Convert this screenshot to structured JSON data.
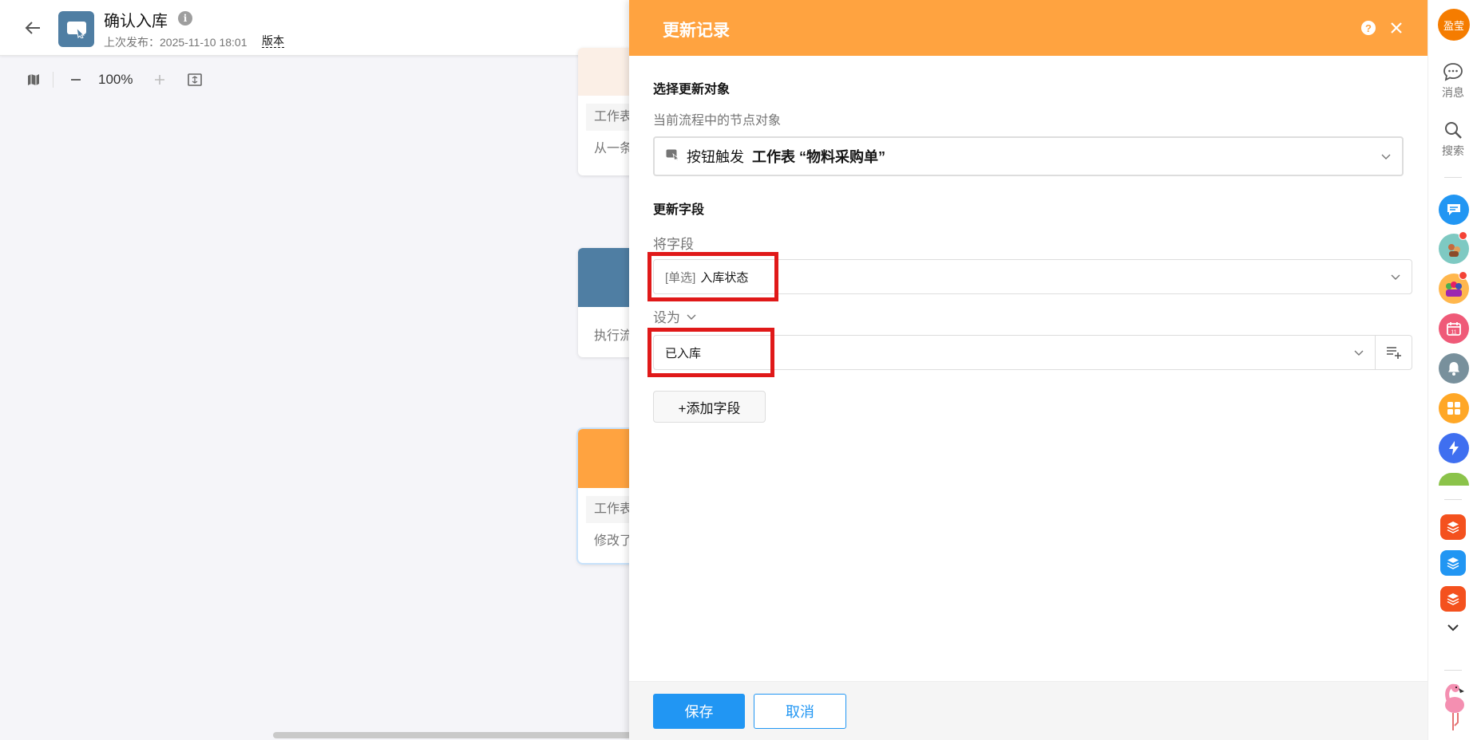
{
  "header": {
    "title": "确认入库",
    "publish_info": "上次发布：2025-11-10 18:01",
    "version_label": "版本"
  },
  "toolbar": {
    "zoom": "100%"
  },
  "canvas": {
    "node1": {
      "tag": "工作表",
      "text": "从一条"
    },
    "node2": {
      "text": "执行流"
    },
    "node3": {
      "tag": "工作表",
      "text": "修改了"
    }
  },
  "panel": {
    "title": "更新记录",
    "target_section": "选择更新对象",
    "target_hint": "当前流程中的节点对象",
    "target_trigger": "按钮触发",
    "target_table": "工作表 “物料采购单”",
    "update_section": "更新字段",
    "field_label": "将字段",
    "field_type": "[单选]",
    "field_name": "入库状态",
    "set_to_label": "设为",
    "value": "已入库",
    "add_field": "+添加字段",
    "save": "保存",
    "cancel": "取消"
  },
  "rail": {
    "user_avatar": "盈莹",
    "messages": "消息",
    "search": "搜索"
  },
  "colors": {
    "panel_header": "#ffa340",
    "primary": "#2196f3",
    "highlight": "#e01919",
    "app_logo": "#4f7ea3"
  }
}
